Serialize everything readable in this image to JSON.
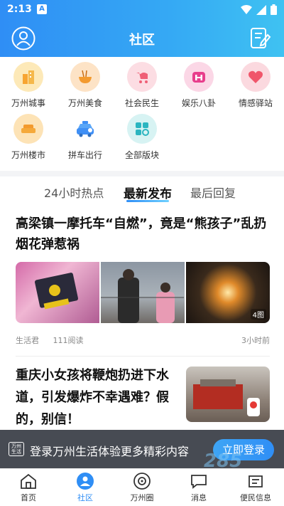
{
  "status_bar": {
    "time": "2:13",
    "notification_badge": "A"
  },
  "header": {
    "title": "社区",
    "left_icon": "user-avatar-icon",
    "right_icon": "edit-note-icon"
  },
  "categories": [
    {
      "label": "万州城事",
      "icon": "city-building-icon",
      "color": "#fde9b8"
    },
    {
      "label": "万州美食",
      "icon": "noodle-bowl-icon",
      "color": "#fde3c6"
    },
    {
      "label": "社会民生",
      "icon": "stroller-icon",
      "color": "#fcdde3"
    },
    {
      "label": "娱乐八卦",
      "icon": "entertainment-icon",
      "color": "#fbd7e6"
    },
    {
      "label": "情感驿站",
      "icon": "heart-gift-icon",
      "color": "#fbd9df"
    },
    {
      "label": "万州楼市",
      "icon": "sofa-icon",
      "color": "#fde3b6"
    },
    {
      "label": "拼车出行",
      "icon": "taxi-icon",
      "color": "#ffffff"
    },
    {
      "label": "全部版块",
      "icon": "grid-icon",
      "color": "#d7f3f3"
    }
  ],
  "tabs": [
    {
      "label": "24小时热点",
      "active": false
    },
    {
      "label": "最新发布",
      "active": true
    },
    {
      "label": "最后回复",
      "active": false
    }
  ],
  "posts": [
    {
      "title": "高梁镇一摩托车“自燃”，竟是“熊孩子”乱扔烟花弹惹祸",
      "author": "生活君",
      "reads": "111阅读",
      "time": "3小时前",
      "image_count": "4图"
    },
    {
      "title": "重庆小女孩将鞭炮扔进下水道，引发爆炸不幸遇难？假的，别信！"
    }
  ],
  "login_banner": {
    "logo_text": "万州生活",
    "text": "登录万州生活体验更多精彩内容",
    "button": "立即登录"
  },
  "tabbar": [
    {
      "label": "首页",
      "icon": "home-icon",
      "active": false
    },
    {
      "label": "社区",
      "icon": "community-icon",
      "active": true
    },
    {
      "label": "万州圈",
      "icon": "circle-icon",
      "active": false
    },
    {
      "label": "消息",
      "icon": "message-icon",
      "active": false
    },
    {
      "label": "便民信息",
      "icon": "info-icon",
      "active": false
    }
  ],
  "colors": {
    "brand": "#2f8ef5",
    "brand_light": "#3fc2f2"
  }
}
